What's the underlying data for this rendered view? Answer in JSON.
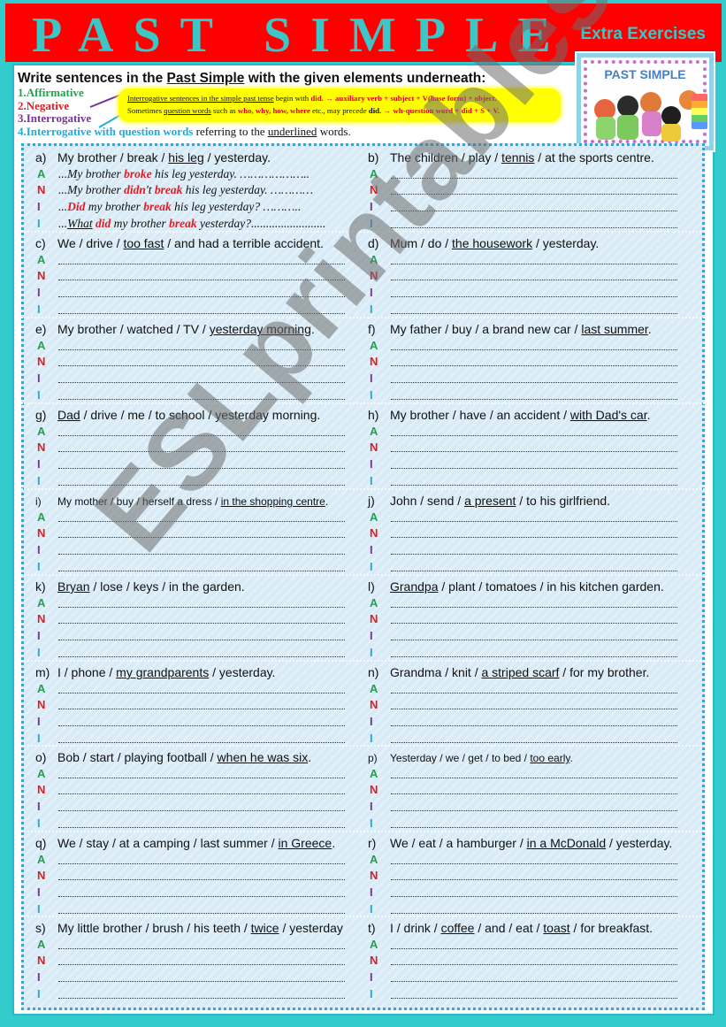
{
  "header": {
    "title": "PAST SIMPLE",
    "subtitle": "Extra Exercises"
  },
  "instructions": {
    "prefix": "Write sentences in the ",
    "underlined": "Past Simple",
    "suffix": " with the given elements underneath:",
    "legend": [
      "1.Affirmative",
      "2.Negative",
      "3.Interrogative",
      "4.Interrogative with question words"
    ],
    "legend4_rest_a": " referring to the ",
    "legend4_underlined": "underlined",
    "legend4_rest_b": " words."
  },
  "note": {
    "line1_u": "Interrogative sentences in the simple past tense",
    "line1_a": " begin with ",
    "line1_did": "did",
    "line1_rule": ".  →  auxiliary verb + subject + V(base form) + object.",
    "line2_a": "Sometimes ",
    "line2_u": "question words",
    "line2_b": " such as ",
    "line2_words": "who, why, how, where",
    "line2_c": " etc., may precede ",
    "line2_did": "did.",
    "line2_rule": "  → wh-question word + did + S + V."
  },
  "picture": {
    "title": "PAST SIMPLE"
  },
  "labels": {
    "a": "A",
    "n": "N",
    "i": "I",
    "w": "I"
  },
  "example": {
    "letter": "a)",
    "parts": [
      "My brother / break / ",
      "his leg",
      " / yesterday."
    ],
    "answers": {
      "aff": [
        "...My brother ",
        "broke",
        " his leg yesterday. ……………….."
      ],
      "neg": [
        "...My brother ",
        "didn",
        "'t ",
        "break",
        " his leg yesterday. …………"
      ],
      "int": [
        "...",
        "Did",
        " my brother ",
        "break",
        " his leg yesterday? ……….."
      ],
      "wh": [
        "...",
        "What",
        " ",
        "did",
        " my brother ",
        "break",
        " yesterday?........................."
      ]
    }
  },
  "exercises": [
    {
      "letter": "b)",
      "parts": [
        "The children / play / ",
        "tennis",
        " / at the sports centre."
      ]
    },
    {
      "letter": "c)",
      "parts": [
        "We / drive / ",
        "too fast",
        " / and had a terrible accident."
      ]
    },
    {
      "letter": "d)",
      "parts": [
        "Mum / do / ",
        "the housework",
        " / yesterday."
      ]
    },
    {
      "letter": "e)",
      "parts": [
        "My brother / watched / TV / ",
        "yesterday morning",
        "."
      ]
    },
    {
      "letter": "f)",
      "parts": [
        "My father / buy / a brand new car / ",
        "last summer",
        "."
      ]
    },
    {
      "letter": "g)",
      "parts": [
        "",
        "Dad",
        " / drive / me / to school / yesterday morning."
      ]
    },
    {
      "letter": "h)",
      "parts": [
        "My brother / have / an accident / ",
        "with Dad's car",
        "."
      ]
    },
    {
      "letter": "i)",
      "parts": [
        "My mother / buy / herself a dress / ",
        "in the shopping centre",
        "."
      ]
    },
    {
      "letter": "j)",
      "parts": [
        "John / send / ",
        "a present",
        " / to his girlfriend."
      ]
    },
    {
      "letter": "k)",
      "parts": [
        "",
        "Bryan",
        " / lose / keys / in the garden."
      ]
    },
    {
      "letter": "l)",
      "parts": [
        "",
        "Grandpa",
        " / plant / tomatoes / in his kitchen garden."
      ]
    },
    {
      "letter": "m)",
      "parts": [
        "I / phone / ",
        "my grandparents",
        " / yesterday."
      ]
    },
    {
      "letter": "n)",
      "parts": [
        "Grandma / knit / ",
        "a striped scarf",
        " / for my brother."
      ]
    },
    {
      "letter": "o)",
      "parts": [
        "Bob / start / playing football / ",
        "when he was six",
        "."
      ]
    },
    {
      "letter": "p)",
      "parts": [
        "Yesterday / we / get / to bed / ",
        "too early",
        "."
      ]
    },
    {
      "letter": "q)",
      "parts": [
        "We / stay / at a camping / last summer / ",
        "in Greece",
        "."
      ]
    },
    {
      "letter": "r)",
      "parts": [
        "We / eat / a hamburger / ",
        "in a McDonald",
        " / yesterday."
      ]
    },
    {
      "letter": "s)",
      "parts": [
        "My little brother / brush / his teeth / ",
        "twice",
        " / yesterday"
      ]
    },
    {
      "letter": "t)",
      "parts": [
        "I / drink / ",
        "coffee",
        " / and / eat / ",
        "toast",
        " / for breakfast."
      ]
    }
  ],
  "watermark": "ESLprintables.com"
}
